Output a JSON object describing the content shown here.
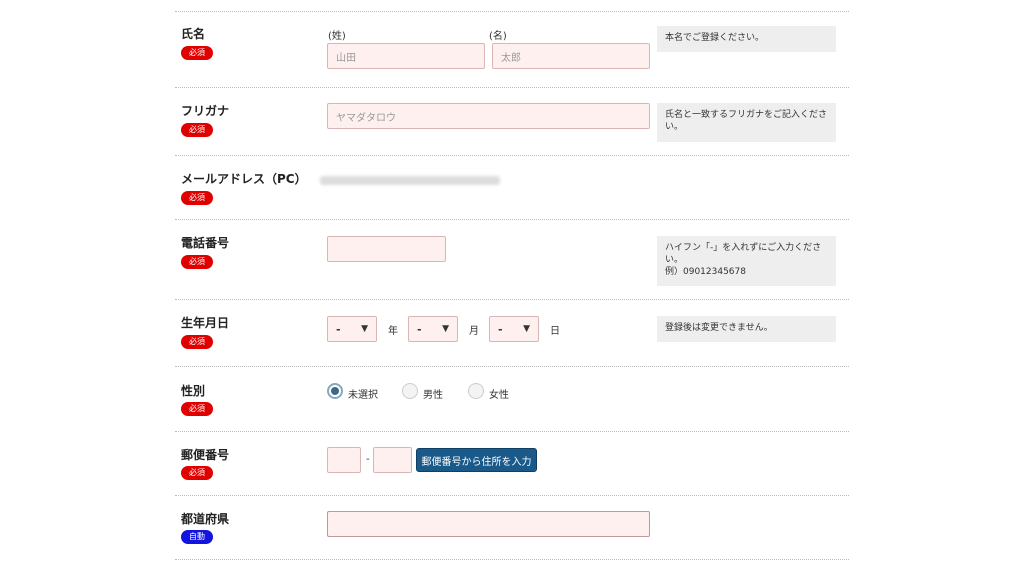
{
  "badges": {
    "required": "必須",
    "auto": "自動"
  },
  "name": {
    "label": "氏名",
    "last_sub": "(姓)",
    "first_sub": "(名)",
    "last_placeholder": "山田",
    "first_placeholder": "太郎",
    "help": "本名でご登録ください。"
  },
  "furigana": {
    "label": "フリガナ",
    "placeholder": "ヤマダタロウ",
    "help": "氏名と一致するフリガナをご記入ください。"
  },
  "email": {
    "label": "メールアドレス（PC）"
  },
  "phone": {
    "label": "電話番号",
    "help_line1": "ハイフン「-」を入れずにご入力ください。",
    "help_line2": "例）09012345678"
  },
  "birthday": {
    "label": "生年月日",
    "year_value": "-",
    "month_value": "-",
    "day_value": "-",
    "year_unit": "年",
    "month_unit": "月",
    "day_unit": "日",
    "arrow": "▼",
    "help": "登録後は変更できません。"
  },
  "gender": {
    "label": "性別",
    "options": [
      "未選択",
      "男性",
      "女性"
    ],
    "selected": "未選択"
  },
  "zip": {
    "label": "郵便番号",
    "dash": "-",
    "button": "郵便番号から住所を入力"
  },
  "prefecture": {
    "label": "都道府県"
  },
  "colors": {
    "required_badge": "#e00000",
    "auto_badge": "#1414e0",
    "input_bg": "#fff0f0",
    "help_bg": "#eeeeee",
    "button_bg": "#1a5a8a"
  }
}
